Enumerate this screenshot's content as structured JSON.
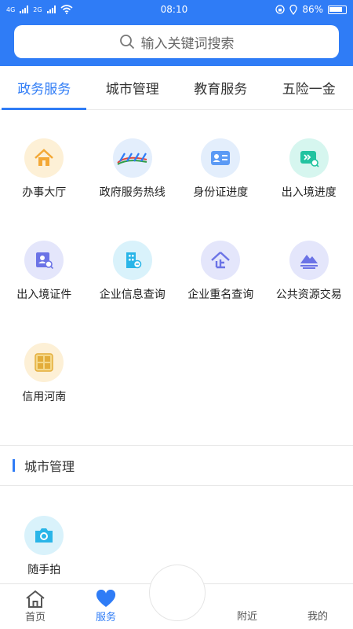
{
  "status": {
    "time": "08:10",
    "battery": "86%",
    "sim": "4G",
    "sim2": "2G"
  },
  "search": {
    "placeholder": "输入关键词搜索"
  },
  "tabs": [
    {
      "label": "政务服务",
      "active": true
    },
    {
      "label": "城市管理",
      "active": false
    },
    {
      "label": "教育服务",
      "active": false
    },
    {
      "label": "五险一金",
      "active": false
    }
  ],
  "services": [
    {
      "label": "办事大厅",
      "icon": "house-icon"
    },
    {
      "label": "政府服务热线",
      "icon": "hotline-12345-icon"
    },
    {
      "label": "身份证进度",
      "icon": "id-card-icon"
    },
    {
      "label": "出入境进度",
      "icon": "exit-entry-progress-icon"
    },
    {
      "label": "出入境证件",
      "icon": "document-search-icon"
    },
    {
      "label": "企业信息查询",
      "icon": "building-icon"
    },
    {
      "label": "企业重名查询",
      "icon": "enterprise-icon"
    },
    {
      "label": "公共资源交易",
      "icon": "mountain-icon"
    },
    {
      "label": "信用河南",
      "icon": "credit-henan-icon"
    }
  ],
  "city_section": {
    "title": "城市管理"
  },
  "city_services": [
    {
      "label": "随手拍",
      "icon": "camera-icon"
    }
  ],
  "bottom_nav": {
    "home": "首页",
    "service": "服务",
    "nearby": "附近",
    "mine": "我的"
  },
  "colors": {
    "accent": "#2f7cf6"
  }
}
